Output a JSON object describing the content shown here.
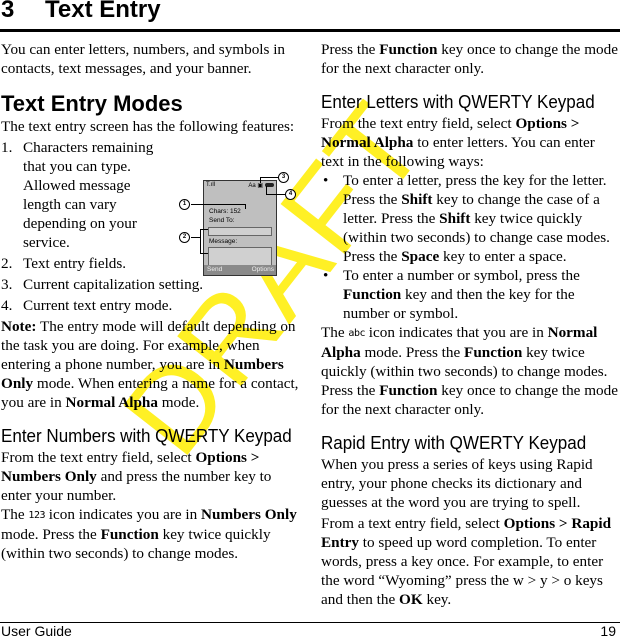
{
  "chapter": {
    "number": "3",
    "title": "Text Entry"
  },
  "left": {
    "intro": "You can enter letters, numbers, and symbols in contacts, text messages, and your banner.",
    "modes_heading": "Text Entry Modes",
    "modes_intro": "The text entry screen has the following features:",
    "list": [
      {
        "n": "1.",
        "text": "Characters remaining that you can type. Allowed message length can vary depending on your service."
      },
      {
        "n": "2.",
        "text": "Text entry fields."
      },
      {
        "n": "3.",
        "text": "Current capitalization setting."
      },
      {
        "n": "4.",
        "text": "Current text entry mode."
      }
    ],
    "note": {
      "label": "Note:",
      "t1": " The entry mode will default depending on the task you are doing. For example, when entering a phone number, you are in ",
      "b1": "Numbers Only",
      "t2": " mode. When entering a name for a contact, you are in ",
      "b2": "Normal Alpha",
      "t3": " mode."
    },
    "numbers_heading": "Enter Numbers with QWERTY Keypad",
    "numbers_p1": {
      "t1": "From the text entry field, select ",
      "b1": "Options > Numbers Only",
      "t2": " and press the number key to enter your number."
    },
    "numbers_p2": {
      "t1": "The ",
      "icon": "123",
      "t2": " icon indicates you are in ",
      "b1": "Numbers Only",
      "t3": " mode. Press the ",
      "b2": "Function",
      "t4": " key twice quickly (within two seconds) to change modes."
    }
  },
  "phone": {
    "status_left": "T.ıll",
    "status_right": "Aa",
    "chars": "Chars: 152",
    "send_to": "Send To:",
    "message": "Message:",
    "softkey_left": "Send",
    "softkey_right": "Options",
    "callouts": [
      "1",
      "2",
      "3",
      "4"
    ]
  },
  "right": {
    "cont": {
      "t1": "Press the ",
      "b1": "Function",
      "t2": " key once to change the mode for the next character only."
    },
    "letters_heading": "Enter Letters with QWERTY Keypad",
    "letters_p1": {
      "t1": "From the text entry field, select ",
      "b1": "Options > Normal Alpha",
      "t2": " to enter letters. You can enter text in the following ways:"
    },
    "bullets": [
      {
        "t1": "To enter a letter, press the key for the letter. Press the ",
        "b1": "Shift",
        "t2": " key to change the case of a letter. Press the ",
        "b2": "Shift",
        "t3": " key twice quickly (within two seconds) to change case modes. Press the ",
        "b3": "Space",
        "t4": " key to enter a space."
      },
      {
        "t1": "To enter a number or symbol, press the ",
        "b1": "Function",
        "t2": " key and then the key for the number or symbol."
      }
    ],
    "alpha_p": {
      "t1": "The ",
      "icon": "abc",
      "t2": " icon indicates that you are in ",
      "b1": "Normal Alpha",
      "t3": " mode. Press the ",
      "b2": "Function",
      "t4": " key twice quickly (within two seconds) to change modes. Press the ",
      "b3": "Function",
      "t5": " key once to change the mode for the next character only."
    },
    "rapid_heading": "Rapid Entry with QWERTY Keypad",
    "rapid_p1": "When you press a series of keys using Rapid entry, your phone checks its dictionary and guesses at the word you are trying to spell.",
    "rapid_p2": {
      "t1": "From a text entry field, select ",
      "b1": "Options > Rapid Entry",
      "t2": " to speed up word completion. To enter words, press a key once. For example, to enter the word “Wyoming” press the w > y > o keys and then the ",
      "b2": "OK",
      "t3": " key."
    }
  },
  "watermark": "DRAFT",
  "footer": {
    "left": "User Guide",
    "page": "19"
  },
  "colors": {
    "watermark": "#ffee00",
    "text": "#000000"
  }
}
